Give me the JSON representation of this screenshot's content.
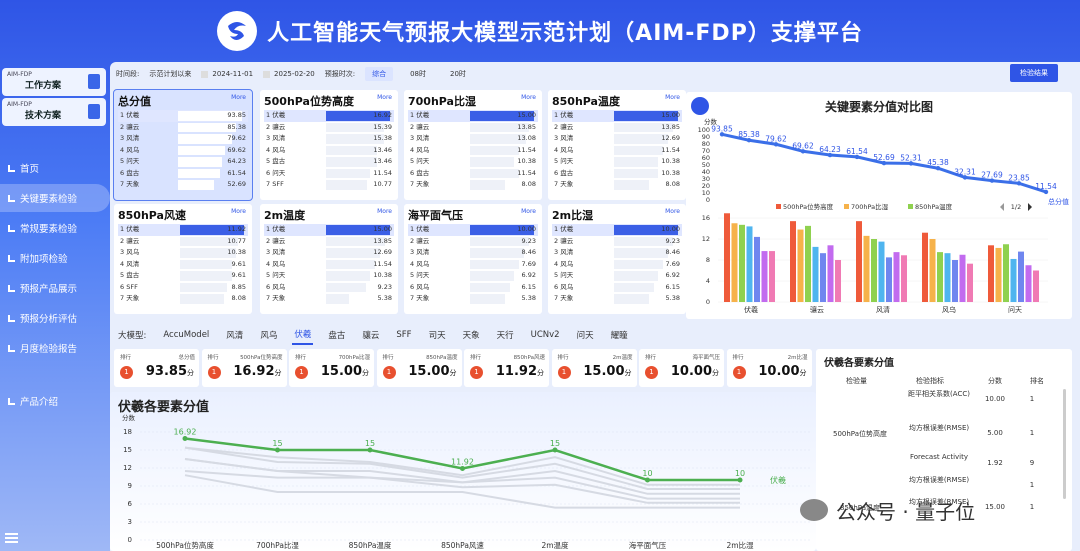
{
  "header": {
    "title": "人工智能天气预报大模型示范计划（AIM-FDP）支撑平台"
  },
  "sidebar": {
    "cards": [
      {
        "small": "AIM-FDP",
        "big": "工作方案"
      },
      {
        "small": "AIM-FDP",
        "big": "技术方案"
      }
    ],
    "nav": [
      "首页",
      "关键要素检验",
      "常规要素检验",
      "附加项检验",
      "预报产品展示",
      "预报分析评估",
      "月度检验报告",
      "产品介绍"
    ]
  },
  "filters": {
    "period_label": "时间段:",
    "period_value": "示范计划以来",
    "start": "2024-11-01",
    "end": "2025-02-20",
    "forecast_label": "预报时次:",
    "tabs": [
      "综合",
      "08时",
      "20时"
    ],
    "detail_button": "检验结果"
  },
  "cards": [
    {
      "title": "总分值",
      "more": "More",
      "rows": [
        [
          "1 伏羲",
          "93.85",
          1.0
        ],
        [
          "2 骧云",
          "85.38",
          0.91
        ],
        [
          "3 风清",
          "79.62",
          0.85
        ],
        [
          "4 风乌",
          "69.62",
          0.74
        ],
        [
          "5 问天",
          "64.23",
          0.68
        ],
        [
          "6 盘古",
          "61.54",
          0.66
        ],
        [
          "7 天象",
          "52.69",
          0.56
        ]
      ]
    },
    {
      "title": "500hPa位势高度",
      "more": "More",
      "rows": [
        [
          "1 伏羲",
          "16.92",
          1.0
        ],
        [
          "2 骧云",
          "15.39",
          0.91
        ],
        [
          "3 风清",
          "15.38",
          0.91
        ],
        [
          "4 风乌",
          "13.46",
          0.8
        ],
        [
          "5 盘古",
          "13.46",
          0.8
        ],
        [
          "6 问天",
          "11.54",
          0.68
        ],
        [
          "7 SFF",
          "10.77",
          0.64
        ]
      ]
    },
    {
      "title": "700hPa比湿",
      "more": "More",
      "rows": [
        [
          "1 伏羲",
          "15.00",
          1.0
        ],
        [
          "2 骧云",
          "13.85",
          0.92
        ],
        [
          "3 风清",
          "13.08",
          0.87
        ],
        [
          "4 风乌",
          "11.54",
          0.77
        ],
        [
          "5 问天",
          "10.38",
          0.69
        ],
        [
          "6 盘古",
          "11.54",
          0.77
        ],
        [
          "7 天象",
          "8.08",
          0.54
        ]
      ]
    },
    {
      "title": "850hPa温度",
      "more": "More",
      "rows": [
        [
          "1 伏羲",
          "15.00",
          1.0
        ],
        [
          "2 骧云",
          "13.85",
          0.92
        ],
        [
          "3 风清",
          "12.69",
          0.85
        ],
        [
          "4 风乌",
          "11.54",
          0.77
        ],
        [
          "5 问天",
          "10.38",
          0.69
        ],
        [
          "6 盘古",
          "10.38",
          0.69
        ],
        [
          "7 天象",
          "8.08",
          0.54
        ]
      ]
    },
    {
      "title": "850hPa风速",
      "more": "More",
      "rows": [
        [
          "1 伏羲",
          "11.92",
          1.0
        ],
        [
          "2 骧云",
          "10.77",
          0.9
        ],
        [
          "3 风乌",
          "10.38",
          0.87
        ],
        [
          "4 风清",
          "9.61",
          0.81
        ],
        [
          "5 盘古",
          "9.61",
          0.81
        ],
        [
          "6 SFF",
          "8.85",
          0.74
        ],
        [
          "7 天象",
          "8.08",
          0.68
        ]
      ]
    },
    {
      "title": "2m温度",
      "more": "More",
      "rows": [
        [
          "1 伏羲",
          "15.00",
          1.0
        ],
        [
          "2 骧云",
          "13.85",
          0.92
        ],
        [
          "3 风清",
          "12.69",
          0.85
        ],
        [
          "4 风乌",
          "11.54",
          0.77
        ],
        [
          "5 问天",
          "10.38",
          0.69
        ],
        [
          "6 风乌",
          "9.23",
          0.62
        ],
        [
          "7 天象",
          "5.38",
          0.36
        ]
      ]
    },
    {
      "title": "海平面气压",
      "more": "More",
      "rows": [
        [
          "1 伏羲",
          "10.00",
          1.0
        ],
        [
          "2 骧云",
          "9.23",
          0.92
        ],
        [
          "3 风清",
          "8.46",
          0.85
        ],
        [
          "4 风乌",
          "7.69",
          0.77
        ],
        [
          "5 问天",
          "6.92",
          0.69
        ],
        [
          "6 风乌",
          "6.15",
          0.62
        ],
        [
          "7 天象",
          "5.38",
          0.54
        ]
      ]
    },
    {
      "title": "2m比湿",
      "more": "More",
      "rows": [
        [
          "1 伏羲",
          "10.00",
          1.0
        ],
        [
          "2 骧云",
          "9.23",
          0.92
        ],
        [
          "3 风清",
          "8.46",
          0.85
        ],
        [
          "4 风乌",
          "7.69",
          0.77
        ],
        [
          "5 问天",
          "6.92",
          0.69
        ],
        [
          "6 风乌",
          "6.15",
          0.62
        ],
        [
          "7 天象",
          "5.38",
          0.54
        ]
      ]
    }
  ],
  "big_chart": {
    "title": "关键要素分值对比图",
    "ylabel": "分数",
    "legend": [
      "500hPa位势高度",
      "700hPa比湿",
      "850hPa温度"
    ],
    "legend_page": "1/2",
    "line_end_label": "总分值",
    "line_values": [
      93.85,
      85.38,
      79.62,
      69.62,
      64.23,
      61.54,
      52.69,
      52.31,
      45.38,
      32.31,
      27.69,
      23.85,
      11.54
    ],
    "yticks": [
      100,
      90,
      80,
      70,
      60,
      50,
      40,
      30,
      20,
      10,
      0
    ],
    "bar_yticks": [
      16,
      12,
      8,
      4,
      0
    ],
    "bar_categories": [
      "伏羲",
      "骧云",
      "风清",
      "风乌",
      "问天"
    ],
    "series_colors": [
      "#ef5a3a",
      "#f6b24a",
      "#8fd14f",
      "#4fb5ef",
      "#6f86ef",
      "#c26bef",
      "#f07ab4"
    ],
    "bar_values": [
      [
        16.9,
        15.0,
        14.7,
        14.4,
        12.4,
        9.7,
        9.7
      ],
      [
        15.4,
        13.8,
        14.5,
        10.5,
        9.3,
        10.8,
        8.0
      ],
      [
        15.4,
        12.6,
        12.0,
        11.5,
        8.5,
        9.5,
        8.9
      ],
      [
        13.2,
        12.0,
        9.5,
        9.3,
        8.0,
        9.0,
        7.3
      ],
      [
        10.8,
        10.3,
        11.0,
        8.2,
        9.6,
        7.0,
        6.0
      ]
    ]
  },
  "model_tabs": {
    "label": "大模型:",
    "tabs": [
      "AccuModel",
      "风清",
      "风乌",
      "伏羲",
      "盘古",
      "骧云",
      "SFF",
      "司天",
      "天象",
      "天行",
      "UCNv2",
      "问天",
      "耀瞳"
    ]
  },
  "ranks": [
    {
      "rank_label": "排行",
      "title": "总分值",
      "value": "93.85",
      "unit": "分",
      "rank": "1"
    },
    {
      "rank_label": "排行",
      "title": "500hPa位势高度",
      "value": "16.92",
      "unit": "分",
      "rank": "1"
    },
    {
      "rank_label": "排行",
      "title": "700hPa比湿",
      "value": "15.00",
      "unit": "分",
      "rank": "1"
    },
    {
      "rank_label": "排行",
      "title": "850hPa温度",
      "value": "15.00",
      "unit": "分",
      "rank": "1"
    },
    {
      "rank_label": "排行",
      "title": "850hPa风速",
      "value": "11.92",
      "unit": "分",
      "rank": "1"
    },
    {
      "rank_label": "排行",
      "title": "2m温度",
      "value": "15.00",
      "unit": "分",
      "rank": "1"
    },
    {
      "rank_label": "排行",
      "title": "海平面气压",
      "value": "10.00",
      "unit": "分",
      "rank": "1"
    },
    {
      "rank_label": "排行",
      "title": "2m比湿",
      "value": "10.00",
      "unit": "分",
      "rank": "1"
    }
  ],
  "chart_data": {
    "type": "line",
    "title": "伏羲各要素分值",
    "ylabel": "分数",
    "categories": [
      "500hPa位势高度",
      "700hPa比湿",
      "850hPa温度",
      "850hPa风速",
      "2m温度",
      "海平面气压",
      "2m比湿"
    ],
    "yticks": [
      18,
      15,
      12,
      9,
      6,
      3,
      0
    ],
    "ylim": [
      0,
      18
    ],
    "series": [
      {
        "name": "伏羲",
        "color": "#4caf50",
        "values": [
          16.92,
          15,
          15,
          11.92,
          15,
          10,
          10
        ],
        "labels": [
          "16.92",
          "15",
          "15",
          "11.92",
          "15",
          "10",
          "10"
        ]
      }
    ]
  },
  "table": {
    "title": "伏羲各要素分值",
    "headers": [
      "检验量",
      "检验指标",
      "分数",
      "排名"
    ],
    "rows": [
      [
        "",
        "距平相关系数(ACC)",
        "10.00",
        "1"
      ],
      [
        "500hPa位势高度",
        "均方根误差(RMSE)",
        "5.00",
        "1"
      ],
      [
        "",
        "Forecast Activity",
        "1.92",
        "9"
      ],
      [
        "",
        "均方根误差(RMSE)",
        "",
        "1"
      ],
      [
        "850hPa温度",
        "均方根误差(RMSE)",
        "15.00",
        "1"
      ]
    ]
  },
  "watermark": "公众号 · 量子位"
}
